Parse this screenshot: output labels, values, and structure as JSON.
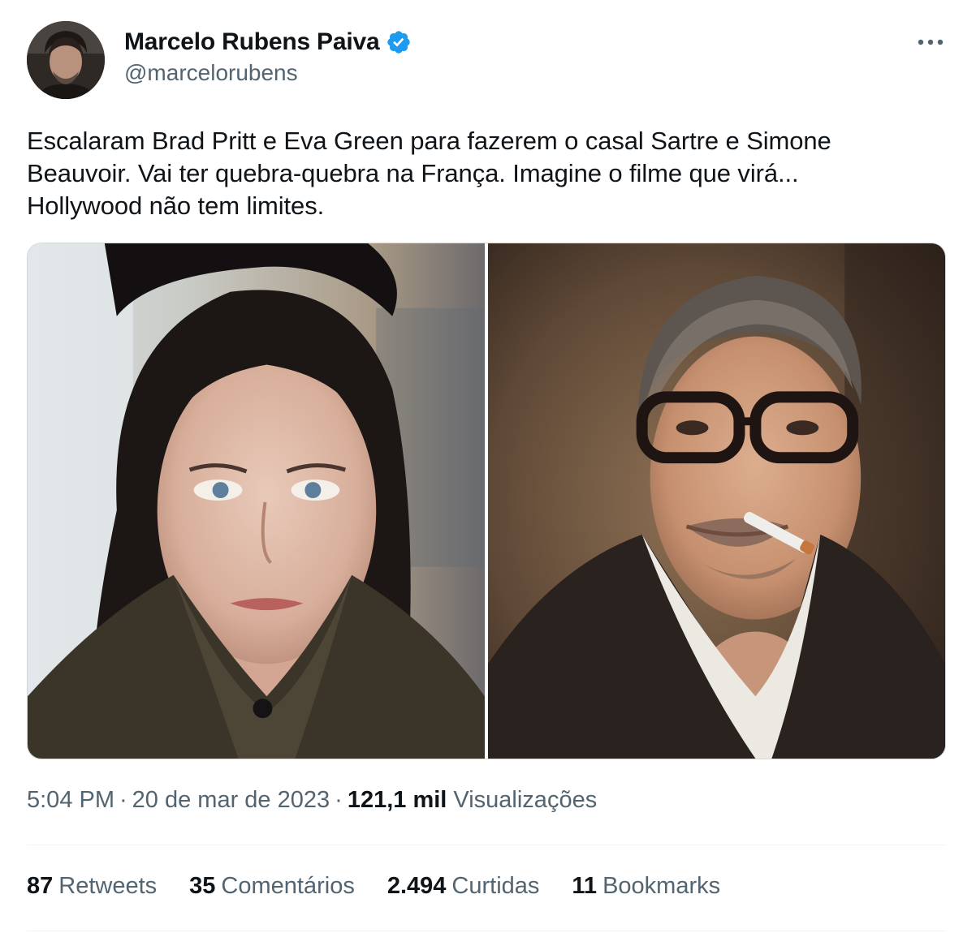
{
  "author": {
    "display_name": "Marcelo Rubens Paiva",
    "handle": "@marcelorubens",
    "verified": true,
    "verified_color": "#1d9bf0"
  },
  "tweet": {
    "text_lines": [
      "Escalaram Brad Pritt e Eva Green para fazerem o casal Sartre e Simone",
      "Beauvoir. Vai ter quebra-quebra na França. Imagine o filme que virá...",
      "Hollywood não tem limites."
    ],
    "time": "5:04 PM",
    "date": "20 de mar de 2023",
    "views_count": "121,1 mil",
    "views_label": "Visualizações"
  },
  "stats": [
    {
      "count": "87",
      "label": "Retweets"
    },
    {
      "count": "35",
      "label": "Comentários"
    },
    {
      "count": "2.494",
      "label": "Curtidas"
    },
    {
      "count": "11",
      "label": "Bookmarks"
    }
  ],
  "media": [
    {
      "kind": "photo",
      "icon": "portrait-woman"
    },
    {
      "kind": "photo",
      "icon": "portrait-man-glasses-cigarette"
    }
  ],
  "colors": {
    "text": "#0f1419",
    "secondary": "#536471",
    "border": "#cfd9de",
    "divider": "#eff3f4"
  }
}
